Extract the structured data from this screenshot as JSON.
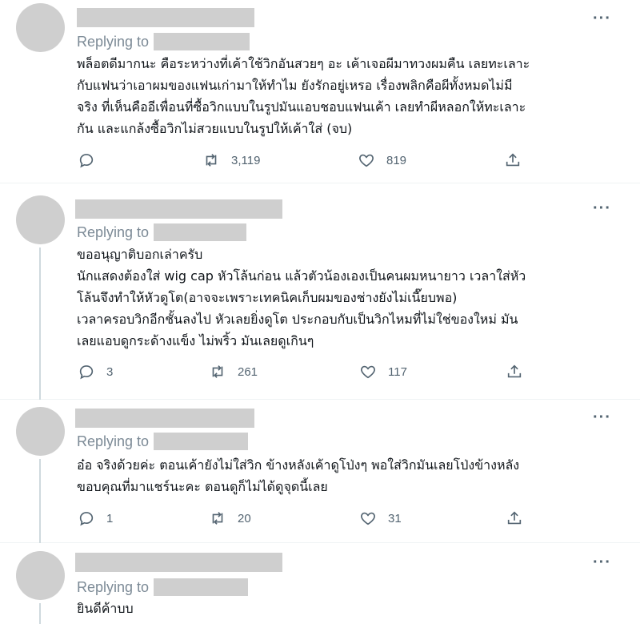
{
  "replying_label": "Replying to",
  "more_label": "···",
  "tweets": [
    {
      "text": "พล็อตดีมากนะ คือระหว่างที่เค้าใช้วิกอันสวยๆ อะ เค้าเจอผีมาทวงผมคืน เลยทะเลาะ\nกับแฟนว่าเอาผมของแฟนเก่ามาให้ทำไม ยังรักอยู่เหรอ เรื่องพลิกคือผีทั้งหมดไม่มี\nจริง ที่เห็นคืออีเพื่อนที่ซื้อวิกแบบในรูปมันแอบชอบแฟนเค้า เลยทำผีหลอกให้ทะเลาะ\nกัน และแกล้งซื้อวิกไม่สวยแบบในรูปให้เค้าใส่ (จบ)",
      "reply_count": "",
      "retweet_count": "3,119",
      "like_count": "819"
    },
    {
      "text": "ขออนุญาติบอกเล่าครับ\nนักแสดงต้องใส่ wig cap หัวโล้นก่อน แล้วตัวน้องเองเป็นคนผมหนายาว เวลาใส่หัว\nโล้นจึงทำให้หัวดูโต(อาจจะเพราะเทคนิคเก็บผมของช่างยังไม่เนี๊ยบพอ)\nเวลาครอบวิกอีกชั้นลงไป หัวเลยยิ่งดูโต ประกอบกับเป็นวิกไหมที่ไม่ใช่ของใหม่ มัน\nเลยแอบดูกระด้างแข็ง ไม่พริ้ว มันเลยดูเกินๆ",
      "reply_count": "3",
      "retweet_count": "261",
      "like_count": "117"
    },
    {
      "text": "อ๋อ จริงด้วยค่ะ ตอนเค้ายังไม่ใส่วิก ข้างหลังเค้าดูโป่งๆ พอใส่วิกมันเลยโป่งข้างหลัง\nขอบคุณที่มาแชร์นะคะ ตอนดูก็ไม่ได้ดูจุดนี้เลย",
      "reply_count": "1",
      "retweet_count": "20",
      "like_count": "31"
    },
    {
      "text": "ยินดีค้าบบ",
      "reply_count": "",
      "retweet_count": "",
      "like_count": ""
    }
  ]
}
